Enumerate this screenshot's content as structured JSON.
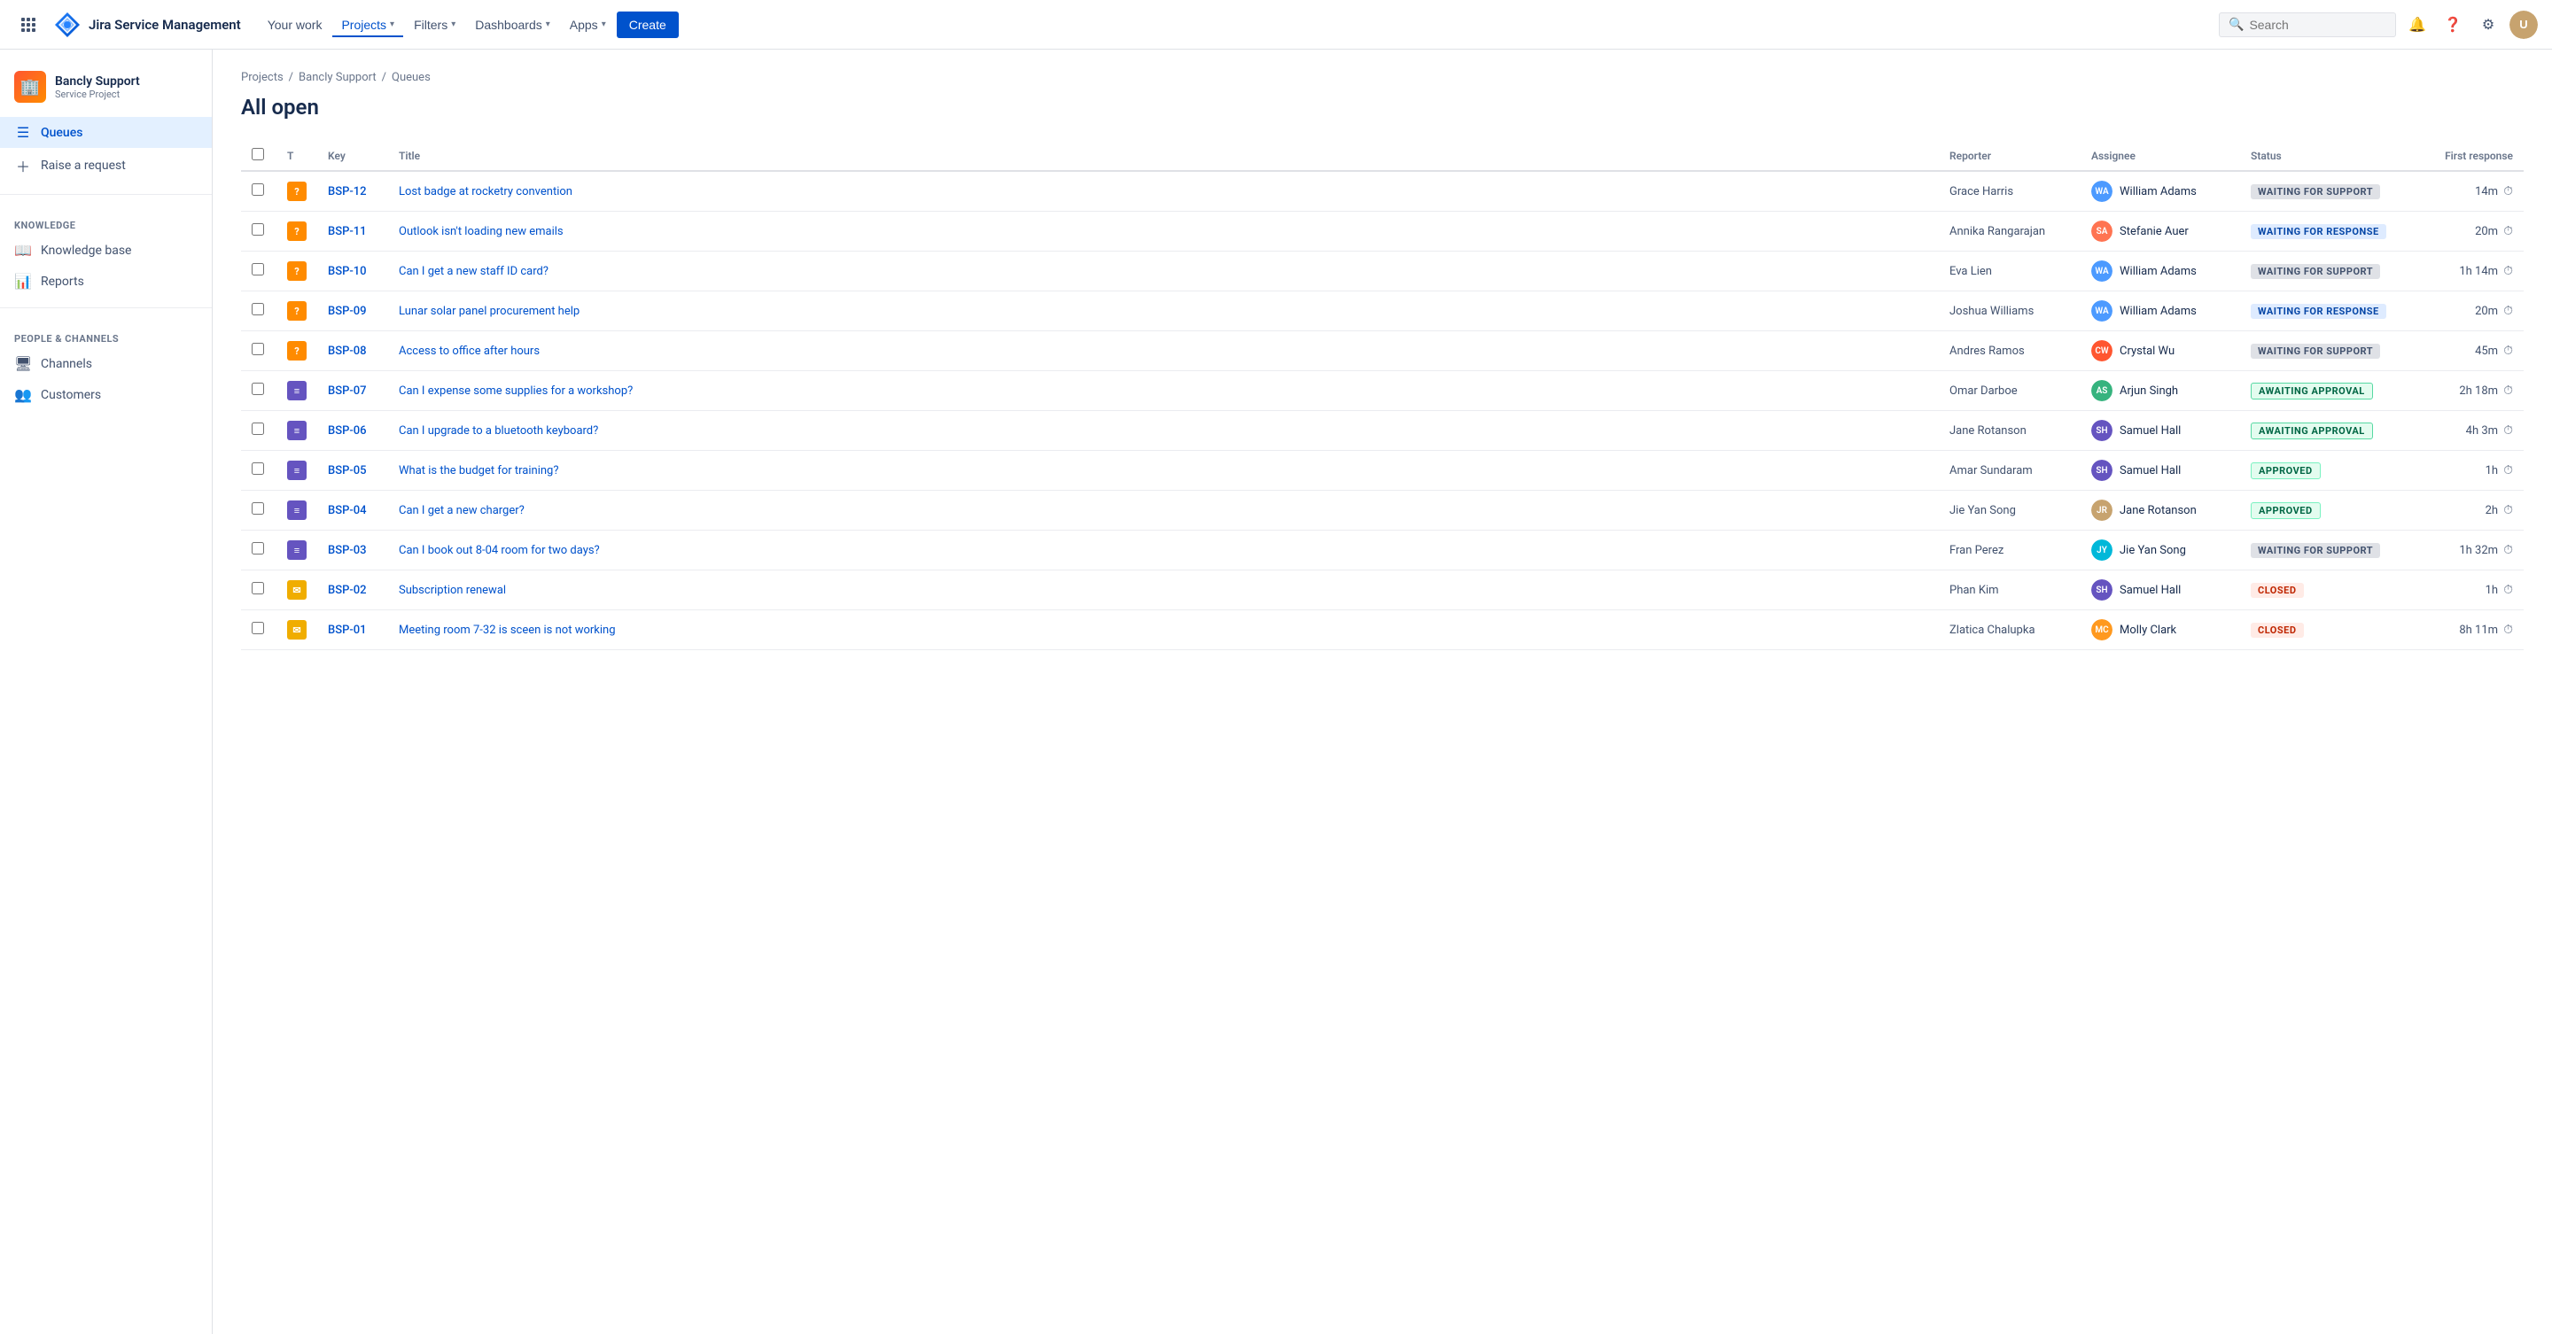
{
  "topnav": {
    "logo_text": "Jira Service Management",
    "nav_items": [
      {
        "label": "Your work",
        "active": false,
        "has_dropdown": false
      },
      {
        "label": "Projects",
        "active": true,
        "has_dropdown": true
      },
      {
        "label": "Filters",
        "active": false,
        "has_dropdown": true
      },
      {
        "label": "Dashboards",
        "active": false,
        "has_dropdown": true
      },
      {
        "label": "Apps",
        "active": false,
        "has_dropdown": true
      }
    ],
    "create_label": "Create",
    "search_placeholder": "Search"
  },
  "sidebar": {
    "project_name": "Bancly Support",
    "project_type": "Service Project",
    "nav_items": [
      {
        "label": "Queues",
        "icon": "queue",
        "active": true
      },
      {
        "label": "Raise a request",
        "icon": "raise",
        "active": false
      }
    ],
    "knowledge_section": "KNOWLEDGE",
    "knowledge_items": [
      {
        "label": "Knowledge base",
        "icon": "knowledge"
      },
      {
        "label": "Reports",
        "icon": "reports"
      }
    ],
    "people_section": "PEOPLE & CHANNELS",
    "people_items": [
      {
        "label": "Channels",
        "icon": "channels"
      },
      {
        "label": "Customers",
        "icon": "customers"
      }
    ]
  },
  "breadcrumb": {
    "items": [
      "Projects",
      "Bancly Support",
      "Queues"
    ]
  },
  "page_title": "All open",
  "table": {
    "columns": [
      "",
      "T",
      "Key",
      "Title",
      "Reporter",
      "Assignee",
      "Status",
      "First response"
    ],
    "rows": [
      {
        "key": "BSP-12",
        "type": "question",
        "title": "Lost badge at rocketry convention",
        "reporter": "Grace Harris",
        "assignee": "William Adams",
        "assignee_initials": "WA",
        "assignee_color": "av-william",
        "status": "WAITING FOR SUPPORT",
        "status_class": "status-waiting-support",
        "response": "14m"
      },
      {
        "key": "BSP-11",
        "type": "question",
        "title": "Outlook isn't loading new emails",
        "reporter": "Annika Rangarajan",
        "assignee": "Stefanie Auer",
        "assignee_initials": "SA",
        "assignee_color": "av-stefanie",
        "status": "WAITING FOR RESPONSE",
        "status_class": "status-waiting-response",
        "response": "20m"
      },
      {
        "key": "BSP-10",
        "type": "question",
        "title": "Can I get a new staff ID card?",
        "reporter": "Eva Lien",
        "assignee": "William Adams",
        "assignee_initials": "WA",
        "assignee_color": "av-william",
        "status": "WAITING FOR SUPPORT",
        "status_class": "status-waiting-support",
        "response": "1h 14m"
      },
      {
        "key": "BSP-09",
        "type": "question",
        "title": "Lunar solar panel procurement help",
        "reporter": "Joshua Williams",
        "assignee": "William Adams",
        "assignee_initials": "WA",
        "assignee_color": "av-william",
        "status": "WAITING FOR RESPONSE",
        "status_class": "status-waiting-response",
        "response": "20m"
      },
      {
        "key": "BSP-08",
        "type": "question",
        "title": "Access to office after hours",
        "reporter": "Andres Ramos",
        "assignee": "Crystal Wu",
        "assignee_initials": "CW",
        "assignee_color": "av-crystal",
        "status": "WAITING FOR SUPPORT",
        "status_class": "status-waiting-support",
        "response": "45m"
      },
      {
        "key": "BSP-07",
        "type": "task",
        "title": "Can I expense some supplies for a workshop?",
        "reporter": "Omar Darboe",
        "assignee": "Arjun Singh",
        "assignee_initials": "AS",
        "assignee_color": "av-arjun",
        "status": "AWAITING APPROVAL",
        "status_class": "status-awaiting-approval",
        "response": "2h 18m"
      },
      {
        "key": "BSP-06",
        "type": "task",
        "title": "Can I upgrade to a bluetooth keyboard?",
        "reporter": "Jane Rotanson",
        "assignee": "Samuel Hall",
        "assignee_initials": "SH",
        "assignee_color": "av-samuel",
        "status": "AWAITING APPROVAL",
        "status_class": "status-awaiting-approval",
        "response": "4h 3m"
      },
      {
        "key": "BSP-05",
        "type": "task",
        "title": "What is the budget for training?",
        "reporter": "Amar Sundaram",
        "assignee": "Samuel Hall",
        "assignee_initials": "SH",
        "assignee_color": "av-samuel",
        "status": "APPROVED",
        "status_class": "status-approved",
        "response": "1h"
      },
      {
        "key": "BSP-04",
        "type": "task",
        "title": "Can I get a new charger?",
        "reporter": "Jie Yan Song",
        "assignee": "Jane Rotanson",
        "assignee_initials": "JR",
        "assignee_color": "av-jane",
        "status": "APPROVED",
        "status_class": "status-approved",
        "response": "2h"
      },
      {
        "key": "BSP-03",
        "type": "task",
        "title": "Can I book out 8-04 room for two days?",
        "reporter": "Fran Perez",
        "assignee": "Jie Yan Song",
        "assignee_initials": "JY",
        "assignee_color": "av-jie",
        "status": "WAITING FOR SUPPORT",
        "status_class": "status-waiting-support",
        "response": "1h 32m"
      },
      {
        "key": "BSP-02",
        "type": "email",
        "title": "Subscription renewal",
        "reporter": "Phan Kim",
        "assignee": "Samuel Hall",
        "assignee_initials": "SH",
        "assignee_color": "av-samuel",
        "status": "CLOSED",
        "status_class": "status-closed",
        "response": "1h"
      },
      {
        "key": "BSP-01",
        "type": "email",
        "title": "Meeting room 7-32 is sceen is not working",
        "reporter": "Zlatica Chalupka",
        "assignee": "Molly Clark",
        "assignee_initials": "MC",
        "assignee_color": "av-molly",
        "status": "CLOSED",
        "status_class": "status-closed",
        "response": "8h 11m"
      }
    ]
  }
}
